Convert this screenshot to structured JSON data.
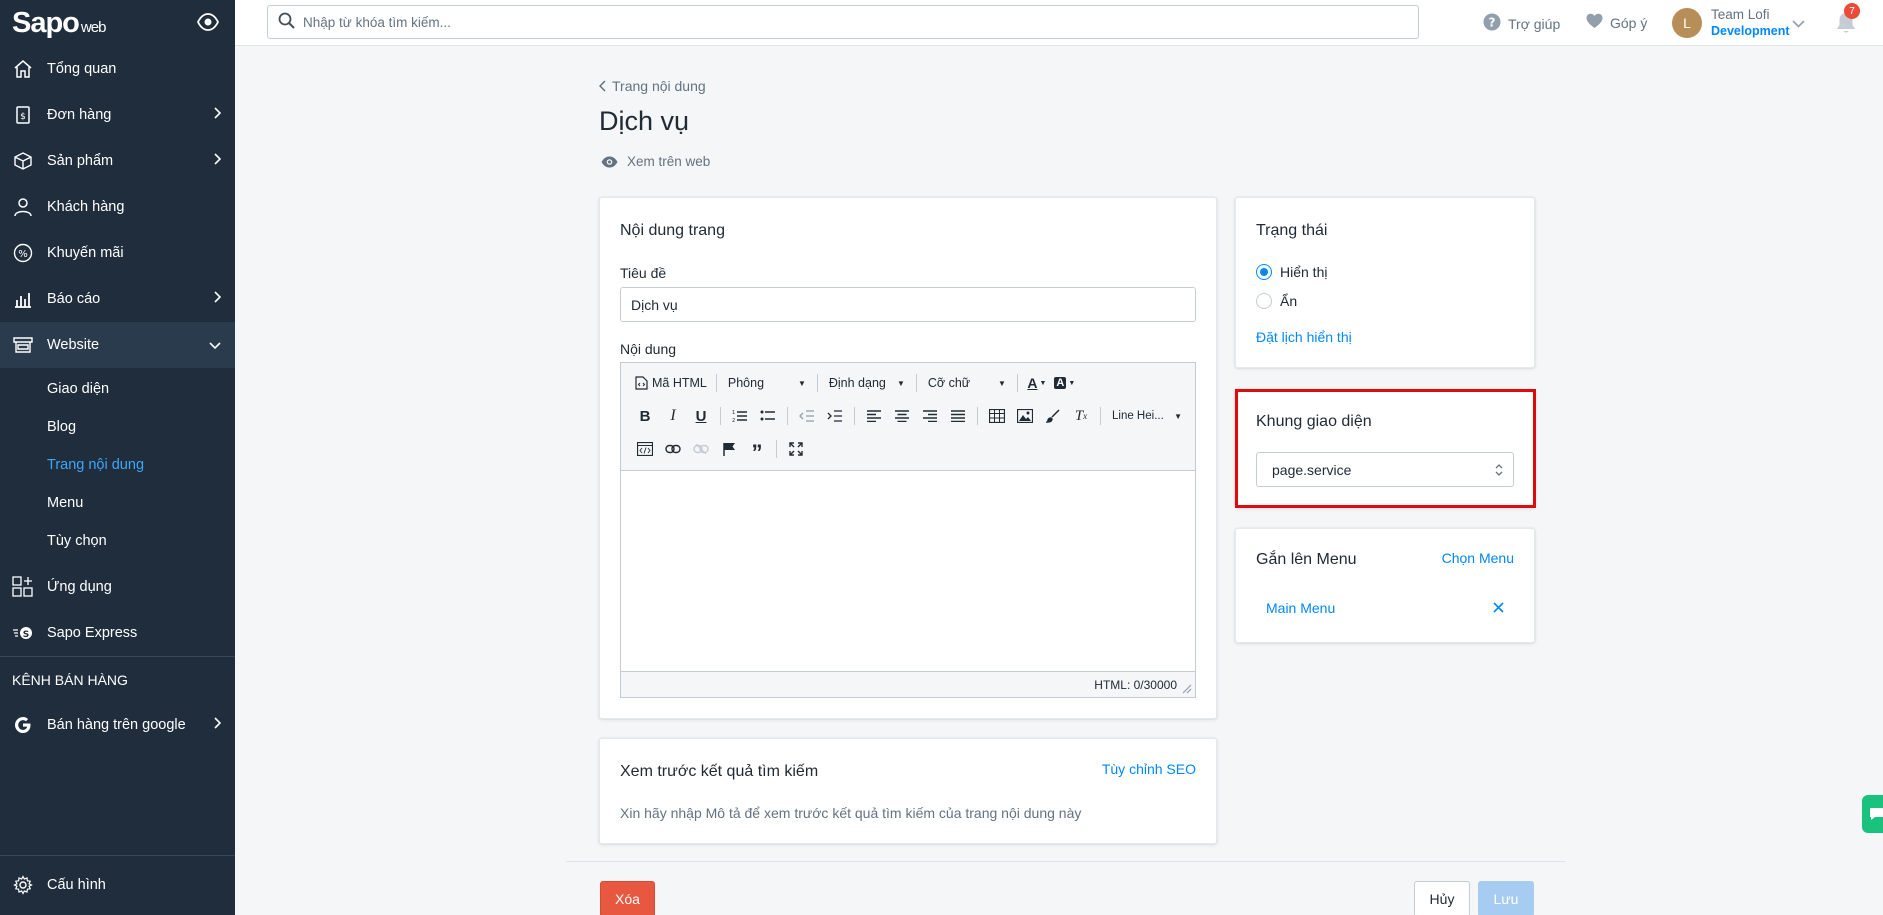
{
  "brand": {
    "logo": "Sapo",
    "logo_suffix": "web"
  },
  "sidebar": {
    "items": [
      {
        "label": "Tổng quan",
        "icon": "home-icon"
      },
      {
        "label": "Đơn hàng",
        "icon": "order-icon",
        "has_children": true
      },
      {
        "label": "Sản phẩm",
        "icon": "box-icon",
        "has_children": true
      },
      {
        "label": "Khách hàng",
        "icon": "user-icon"
      },
      {
        "label": "Khuyến mãi",
        "icon": "percent-icon"
      },
      {
        "label": "Báo cáo",
        "icon": "chart-icon",
        "has_children": true
      },
      {
        "label": "Website",
        "icon": "store-icon",
        "expanded": true
      }
    ],
    "website_sub": [
      {
        "label": "Giao diện"
      },
      {
        "label": "Blog"
      },
      {
        "label": "Trang nội dung",
        "current": true
      },
      {
        "label": "Menu"
      },
      {
        "label": "Tùy chọn"
      }
    ],
    "apps": {
      "label": "Ứng dụng"
    },
    "express": {
      "label": "Sapo Express"
    },
    "channels_heading": "KÊNH BÁN HÀNG",
    "google": {
      "label": "Bán hàng trên google"
    },
    "settings": {
      "label": "Cấu hình"
    }
  },
  "topbar": {
    "search_placeholder": "Nhập từ khóa tìm kiếm...",
    "help_label": "Trợ giúp",
    "feedback_label": "Góp ý",
    "avatar_initial": "L",
    "user_name": "Team Lofi",
    "user_role": "Development",
    "notification_count": "7"
  },
  "page": {
    "breadcrumb": "Trang nội dung",
    "title": "Dịch vụ",
    "view_on_web": "Xem trên web"
  },
  "content_card": {
    "title": "Nội dung trang",
    "title_label": "Tiêu đề",
    "title_value": "Dịch vụ",
    "content_label": "Nội dung",
    "toolbar": {
      "html_label": "Mã HTML",
      "font_label": "Phông",
      "format_label": "Định dạng",
      "size_label": "Cỡ chữ",
      "line_height_label": "Line Hei..."
    },
    "html_counter": "HTML: 0/30000"
  },
  "seo_card": {
    "title": "Xem trước kết quả tìm kiếm",
    "action": "Tùy chỉnh SEO",
    "hint": "Xin hãy nhập Mô tả để xem trước kết quả tìm kiếm của trang nội dung này"
  },
  "status_card": {
    "title": "Trạng thái",
    "options": [
      {
        "label": "Hiển thị",
        "checked": true
      },
      {
        "label": "Ẩn",
        "checked": false
      }
    ],
    "schedule_link": "Đặt lịch hiển thị"
  },
  "template_card": {
    "title": "Khung giao diện",
    "selected": "page.service",
    "highlight_color": "#e00b0b"
  },
  "menu_card": {
    "title": "Gắn lên Menu",
    "action": "Chọn Menu",
    "menu_item": "Main Menu"
  },
  "actions": {
    "delete": "Xóa",
    "cancel": "Hủy",
    "save": "Lưu"
  },
  "colors": {
    "sidebar_bg": "#1f2d3d",
    "accent": "#0088ff",
    "danger": "#e8573f",
    "primary_disabled": "#a6cdf1"
  }
}
